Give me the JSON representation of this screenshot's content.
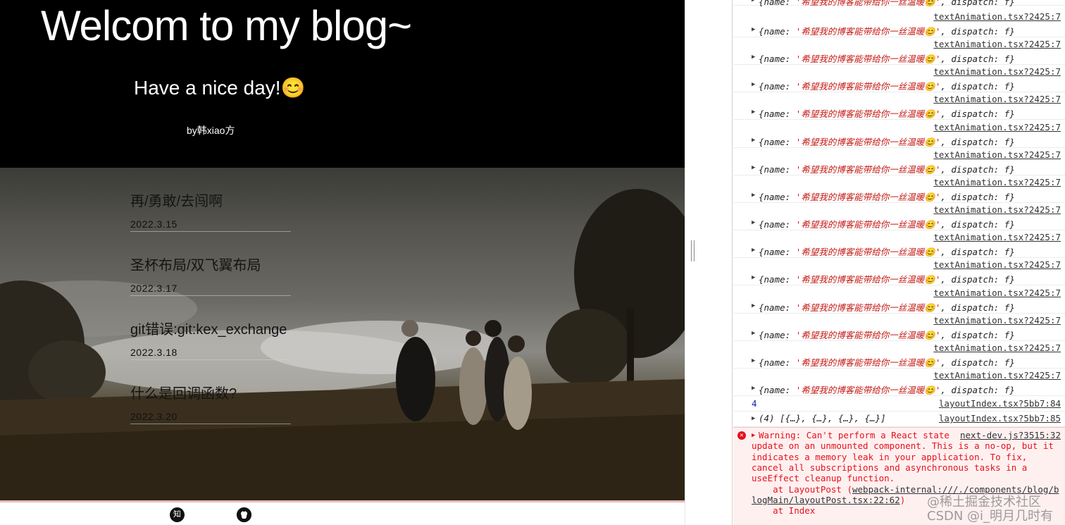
{
  "hero": {
    "title": "Welcom to my blog~",
    "subtitle": "Have a nice day!😊",
    "byline": "by韩xiao方"
  },
  "posts": [
    {
      "title": "再/勇敢/去闯啊",
      "date": "2022.3.15"
    },
    {
      "title": "圣杯布局/双飞翼布局",
      "date": "2022.3.17"
    },
    {
      "title": "git错误:git:kex_exchange",
      "date": "2022.3.18"
    },
    {
      "title": "什么是回调函数?",
      "date": "2022.3.20"
    }
  ],
  "footer": {
    "zhihu_icon": "zhihu-icon",
    "zhihu_glyph": "知",
    "github_icon": "github-icon",
    "github_glyph": "●"
  },
  "console": {
    "log_source": "textAnimation.tsx?2425:7",
    "log_key_name": "name",
    "log_value": "希望我的博客能带给你一丝温暖😊",
    "log_key_dispatch": "dispatch",
    "log_fn": "f",
    "num_value": "4",
    "num_source": "layoutIndex.tsx?5bb7:84",
    "array_text": "(4) [{…}, {…}, {…}, {…}]",
    "array_source": "layoutIndex.tsx?5bb7:85",
    "warning": {
      "source": "next-dev.js?3515:32",
      "line1": "Warning: Can't perform a React state",
      "line2": "update on an unmounted component. This is a no-op, but it",
      "line3": "indicates a memory leak in your application. To fix,",
      "line4": "cancel all subscriptions and asynchronous tasks in a",
      "line5": "useEffect cleanup function.",
      "line6_prefix": "    at LayoutPost (",
      "line6_link": "webpack-internal:///./components/blog/b",
      "line7_link": "logMain/layoutPost.tsx:22:62",
      "line7_suffix": ")",
      "line8": "    at Index"
    }
  },
  "watermark": {
    "line1": "@稀土掘金技术社区",
    "line2": "CSDN @i_明月几时有"
  },
  "colors": {
    "error_red": "#e5121d",
    "string_red": "#c41a16",
    "number_blue": "#1a1aa6"
  }
}
